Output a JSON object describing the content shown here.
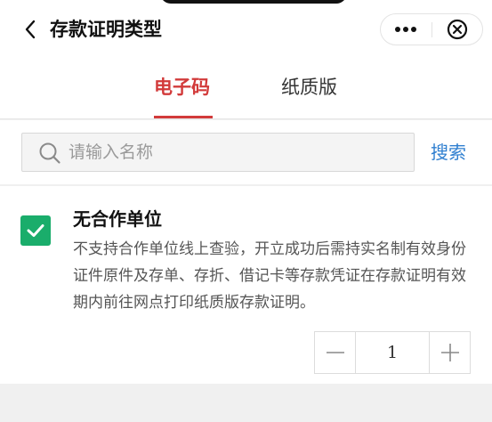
{
  "header": {
    "title": "存款证明类型",
    "back_icon": "chevron-left-icon",
    "more_icon": "more-dots-icon",
    "close_icon": "close-circle-icon"
  },
  "tabs": [
    {
      "label": "电子码",
      "active": true
    },
    {
      "label": "纸质版",
      "active": false
    }
  ],
  "search": {
    "placeholder": "请输入名称",
    "value": "",
    "button_label": "搜索",
    "icon": "search-icon"
  },
  "items": [
    {
      "checked": true,
      "title": "无合作单位",
      "description": "不支持合作单位线上查验，开立成功后需持实名制有效身份证件原件及存单、存折、借记卡等存款凭证在存款证明有效期内前往网点打印纸质版存款证明。",
      "quantity": "1"
    }
  ],
  "colors": {
    "accent": "#d23a3a",
    "link": "#2f7fd0",
    "check": "#1aad6b"
  }
}
